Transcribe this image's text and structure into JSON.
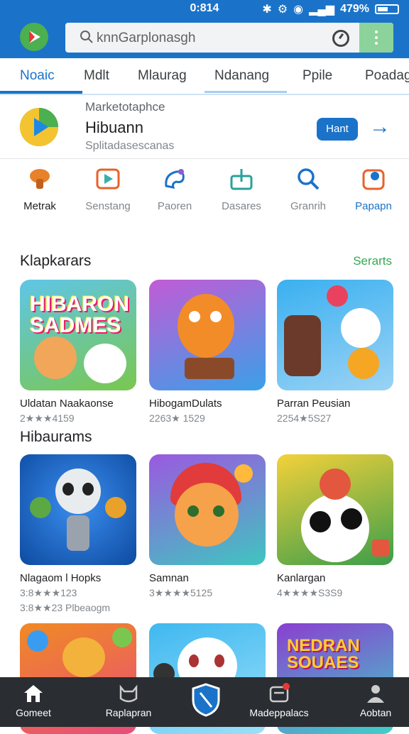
{
  "status": {
    "time": "0:814",
    "battery": "479%"
  },
  "search": {
    "placeholder": "knnGarplonasgh"
  },
  "tabs": [
    {
      "label": "Noaic"
    },
    {
      "label": "Mdlt"
    },
    {
      "label": "Mlaurag"
    },
    {
      "label": "Ndanang"
    },
    {
      "label": "Ppile"
    },
    {
      "label": "Poadag"
    }
  ],
  "feature": {
    "kicker": "Marketotaphce",
    "name": "Hibuann",
    "subtitle": "Splitadasescanas",
    "button": "Hant"
  },
  "categories": [
    {
      "label": "Metrak",
      "icon": "mushroom-icon"
    },
    {
      "label": "Senstang",
      "icon": "play-frame-icon"
    },
    {
      "label": "Paoren",
      "icon": "palette-icon"
    },
    {
      "label": "Dasares",
      "icon": "upload-icon"
    },
    {
      "label": "Granrih",
      "icon": "search-icon"
    },
    {
      "label": "Papapn",
      "icon": "location-icon"
    }
  ],
  "sections": [
    {
      "title": "Klapkarars",
      "link": "Serarts",
      "cards": [
        {
          "title": "Uldatan Naakaonse",
          "meta": "2★★★4159",
          "thumb_text": "HIBARON SADMES",
          "colors": [
            "#f7c948",
            "#5fc6e8",
            "#7ac74f"
          ]
        },
        {
          "title": "HibogamDulats",
          "meta": "2263★ 1529",
          "thumb_text": "",
          "colors": [
            "#c25bd6",
            "#f28c28",
            "#3aa0e8"
          ]
        },
        {
          "title": "Parran Peusian",
          "meta": "2254★5S27",
          "thumb_text": "",
          "colors": [
            "#3ab0f0",
            "#f5a623",
            "#e9425e"
          ]
        }
      ]
    },
    {
      "title": "Hibaurams",
      "link": "",
      "cards": [
        {
          "title": "Nlagaom l Hopks",
          "meta": "3:8★★★123",
          "meta2": "3:8★★23 Plbeaogm",
          "thumb_text": "",
          "colors": [
            "#0d4aa0",
            "#3b8ff0",
            "#e04b3a"
          ]
        },
        {
          "title": "Samnan",
          "meta": "3★★★★5125",
          "thumb_text": "",
          "colors": [
            "#9b59e0",
            "#ffb93b",
            "#3fc5c0"
          ]
        },
        {
          "title": "Kanlargan",
          "meta": "4★★★★S3S9",
          "thumb_text": "",
          "colors": [
            "#f4d13a",
            "#e2573e",
            "#3b9e4a"
          ]
        }
      ]
    },
    {
      "title": "",
      "link": "",
      "cards": [
        {
          "title": "",
          "meta": "",
          "thumb_text": "",
          "colors": [
            "#f08a24",
            "#3a9cf0",
            "#e84c7a"
          ]
        },
        {
          "title": "",
          "meta": "",
          "thumb_text": "",
          "colors": [
            "#3fb8f0",
            "#f6c343",
            "#ffffff"
          ]
        },
        {
          "title": "",
          "meta": "",
          "thumb_text": "NEDRAN SOUAES",
          "colors": [
            "#8a3fd0",
            "#ffcc33",
            "#3fd0c8"
          ]
        }
      ]
    }
  ],
  "nav": [
    {
      "label": "Gomeet",
      "icon": "home-icon"
    },
    {
      "label": "Raplapran",
      "icon": "cat-icon"
    },
    {
      "label": "",
      "icon": "shield-icon"
    },
    {
      "label": "Madeppalacs",
      "icon": "store-icon",
      "badge": "1"
    },
    {
      "label": "Aobtan",
      "icon": "person-icon"
    }
  ]
}
